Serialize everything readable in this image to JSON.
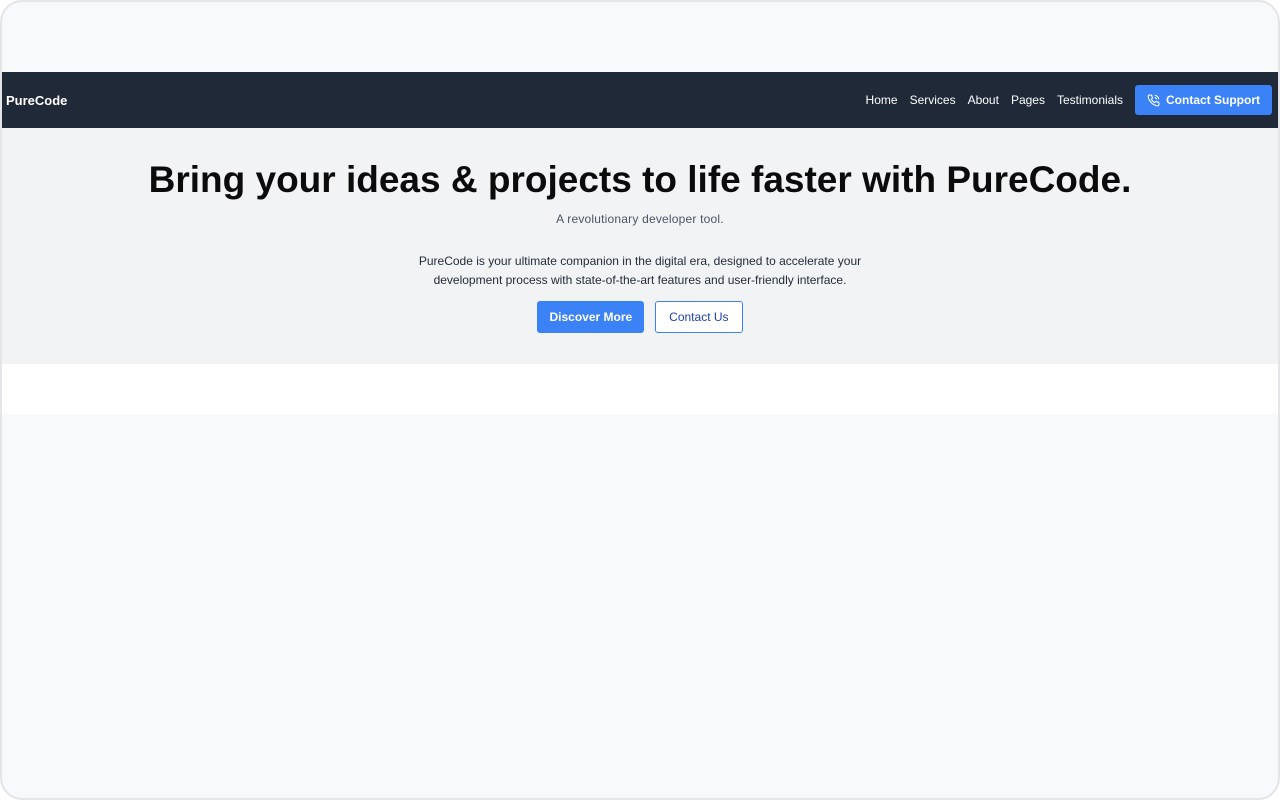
{
  "navbar": {
    "brand": "PureCode",
    "links": [
      "Home",
      "Services",
      "About",
      "Pages",
      "Testimonials"
    ],
    "support_label": "Contact Support",
    "support_icon": "phone-icon"
  },
  "hero": {
    "title": "Bring your ideas & projects to life faster with PureCode.",
    "subtitle": "A revolutionary developer tool.",
    "description": "PureCode is your ultimate companion in the digital era, designed to accelerate your development process with state-of-the-art features and user-friendly interface.",
    "primary_cta": "Discover More",
    "secondary_cta": "Contact Us"
  },
  "colors": {
    "navbar_bg": "#1f2937",
    "accent": "#3b82f6",
    "hero_bg": "#f2f3f5",
    "page_bg": "#f8f9fb"
  }
}
